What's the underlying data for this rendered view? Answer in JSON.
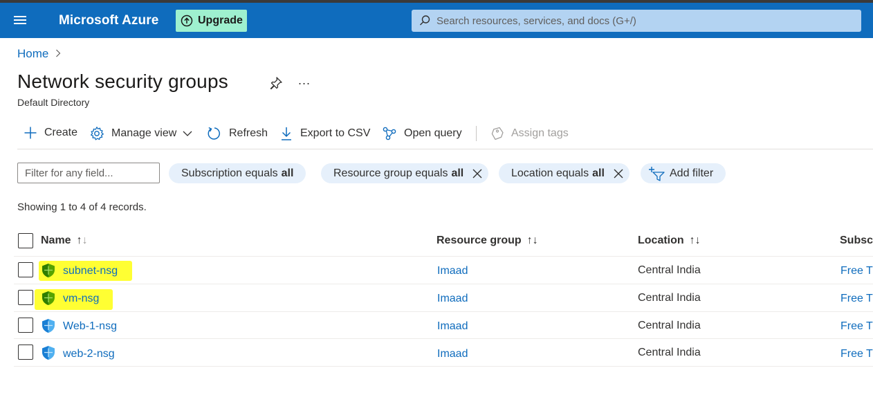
{
  "topbar": {
    "brand": "Microsoft Azure",
    "upgrade_label": "Upgrade",
    "search_placeholder": "Search resources, services, and docs (G+/)"
  },
  "breadcrumb": {
    "home": "Home",
    "separator": ">"
  },
  "page": {
    "title": "Network security groups",
    "subtitle": "Default Directory",
    "more": "..."
  },
  "commands": {
    "create": "Create",
    "manage_view": "Manage view",
    "refresh": "Refresh",
    "export_csv": "Export to CSV",
    "open_query": "Open query",
    "assign_tags": "Assign tags"
  },
  "filters": {
    "input_placeholder": "Filter for any field...",
    "subscription": {
      "prefix": "Subscription equals",
      "value": "all"
    },
    "resource_group": {
      "prefix": "Resource group equals",
      "value": "all"
    },
    "location": {
      "prefix": "Location equals",
      "value": "all"
    },
    "add_filter": "Add filter"
  },
  "records_text": "Showing 1 to 4 of 4 records.",
  "table": {
    "columns": {
      "name": "Name",
      "resource_group": "Resource group",
      "location": "Location",
      "subscription": "Subscr"
    },
    "rows": [
      {
        "name": "subnet-nsg",
        "resource_group": "Imaad",
        "location": "Central India",
        "subscription": "Free Tr",
        "highlighted": true
      },
      {
        "name": "vm-nsg",
        "resource_group": "Imaad",
        "location": "Central India",
        "subscription": "Free Tr",
        "highlighted": true
      },
      {
        "name": "Web-1-nsg",
        "resource_group": "Imaad",
        "location": "Central India",
        "subscription": "Free Tr",
        "highlighted": false
      },
      {
        "name": "web-2-nsg",
        "resource_group": "Imaad",
        "location": "Central India",
        "subscription": "Free Tr",
        "highlighted": false
      }
    ]
  },
  "colors": {
    "header_blue": "#0f6cbd",
    "upgrade_green": "#9ef0cf",
    "link_blue": "#0f6cbd",
    "highlight_yellow": "#ffff33",
    "pill_bg": "#e6f0fb",
    "shield_green": "#57a300",
    "shield_blue": "#50b0f0"
  }
}
